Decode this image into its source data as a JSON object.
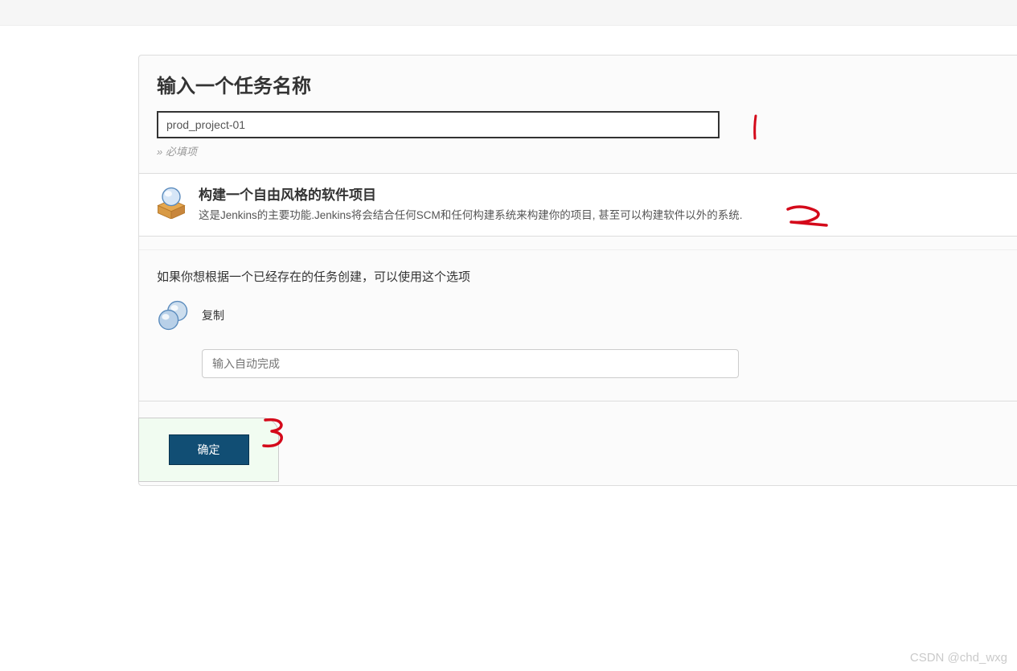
{
  "form": {
    "heading": "输入一个任务名称",
    "name_value": "prod_project-01",
    "required_note": "» 必填项"
  },
  "item_freestyle": {
    "title": "构建一个自由风格的软件项目",
    "description": "这是Jenkins的主要功能.Jenkins将会结合任何SCM和任何构建系统来构建你的项目, 甚至可以构建软件以外的系统."
  },
  "copy_section": {
    "hint": "如果你想根据一个已经存在的任务创建，可以使用这个选项",
    "label": "复制",
    "placeholder": "输入自动完成"
  },
  "footer": {
    "ok_label": "确定"
  },
  "annotations": {
    "one": "1",
    "two": "2",
    "three": "3"
  },
  "watermark": "CSDN @chd_wxg"
}
